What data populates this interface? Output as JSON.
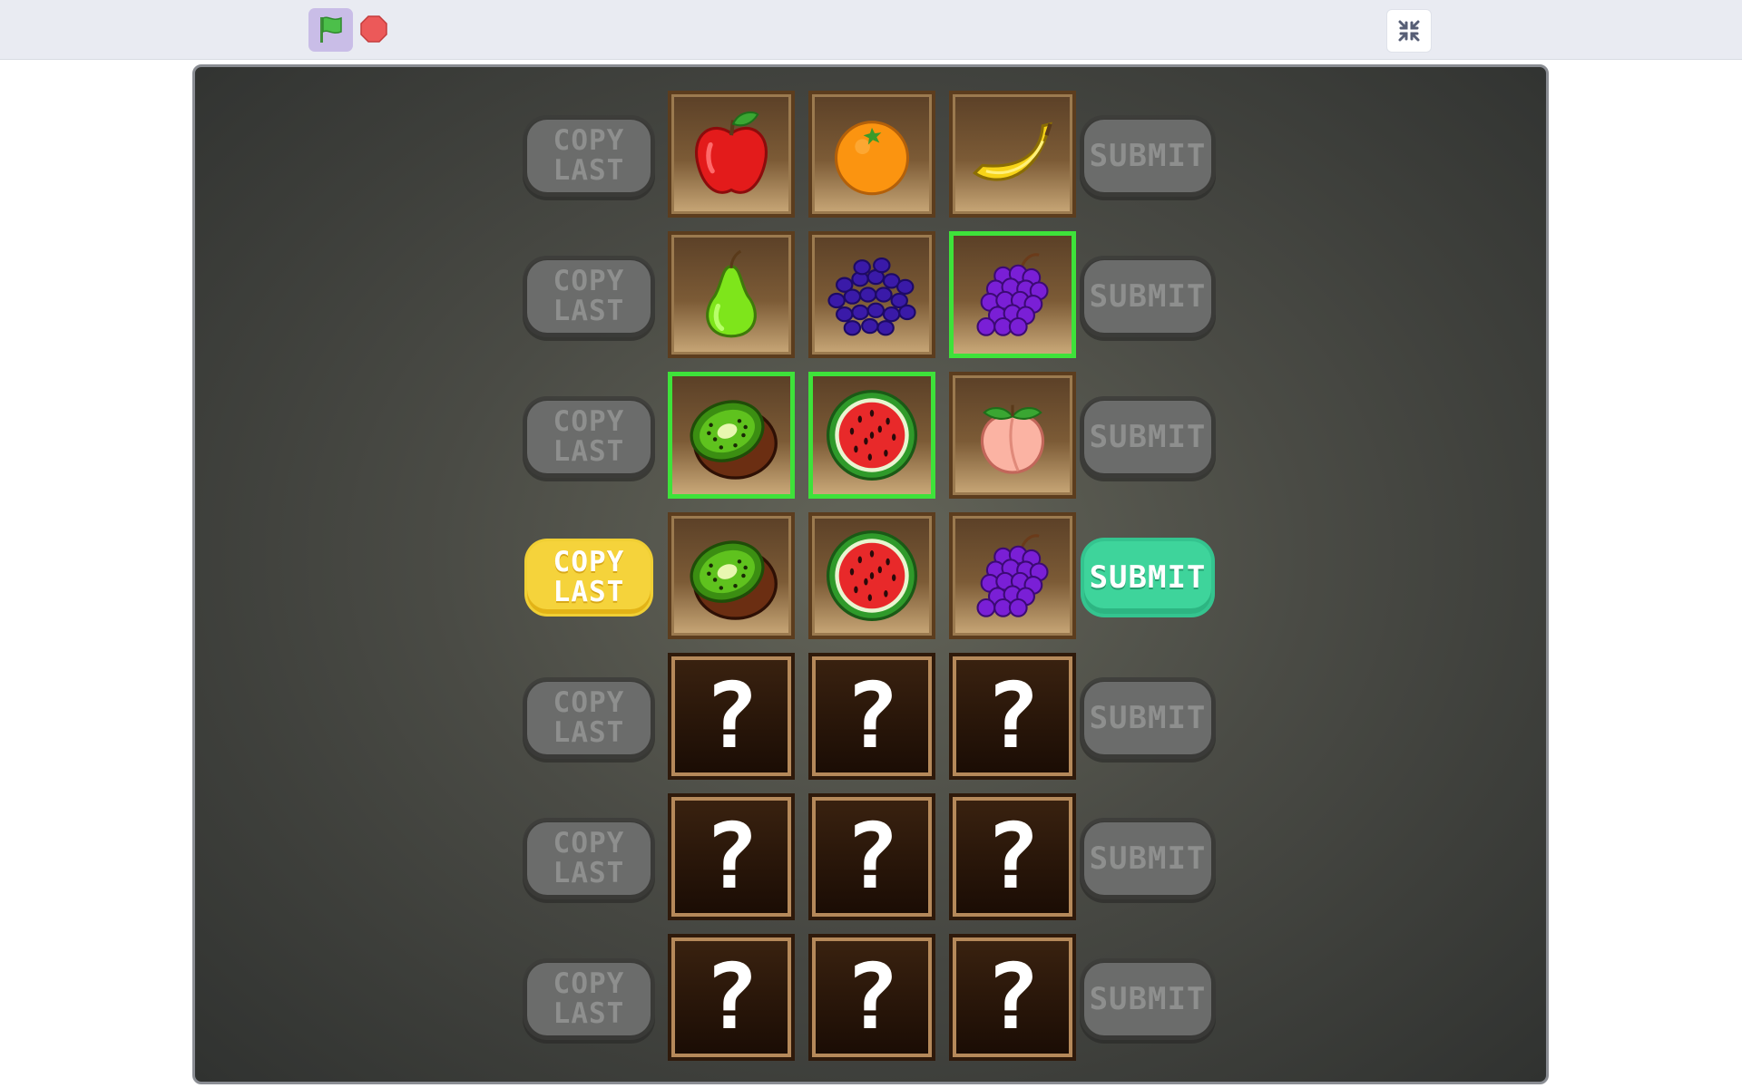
{
  "toolbar": {
    "green_flag_icon": "green-flag",
    "stop_icon": "stop-sign",
    "fullscreen_icon": "exit-fullscreen"
  },
  "game": {
    "copy_label_line1": "COPY",
    "copy_label_line2": "LAST",
    "submit_label": "SUBMIT",
    "mystery_symbol": "?",
    "rows": [
      {
        "state": "done",
        "tiles": [
          {
            "fruit": "apple",
            "highlight": false
          },
          {
            "fruit": "orange",
            "highlight": false
          },
          {
            "fruit": "banana",
            "highlight": false
          }
        ]
      },
      {
        "state": "done",
        "tiles": [
          {
            "fruit": "pear",
            "highlight": false
          },
          {
            "fruit": "blueberries",
            "highlight": false
          },
          {
            "fruit": "grapes",
            "highlight": true
          }
        ]
      },
      {
        "state": "done",
        "tiles": [
          {
            "fruit": "kiwi",
            "highlight": true
          },
          {
            "fruit": "watermelon",
            "highlight": true
          },
          {
            "fruit": "peach",
            "highlight": false
          }
        ]
      },
      {
        "state": "active",
        "tiles": [
          {
            "fruit": "kiwi",
            "highlight": false
          },
          {
            "fruit": "watermelon",
            "highlight": false
          },
          {
            "fruit": "grapes",
            "highlight": false
          }
        ]
      },
      {
        "state": "pending",
        "tiles": [
          {
            "fruit": "unknown"
          },
          {
            "fruit": "unknown"
          },
          {
            "fruit": "unknown"
          }
        ]
      },
      {
        "state": "pending",
        "tiles": [
          {
            "fruit": "unknown"
          },
          {
            "fruit": "unknown"
          },
          {
            "fruit": "unknown"
          }
        ]
      },
      {
        "state": "pending",
        "tiles": [
          {
            "fruit": "unknown"
          },
          {
            "fruit": "unknown"
          },
          {
            "fruit": "unknown"
          }
        ]
      }
    ],
    "colors": {
      "highlight": "#3ee23a",
      "copy_active": "#f5d33b",
      "submit_active": "#3ed49b",
      "button_inactive": "#6b6c6b"
    }
  }
}
